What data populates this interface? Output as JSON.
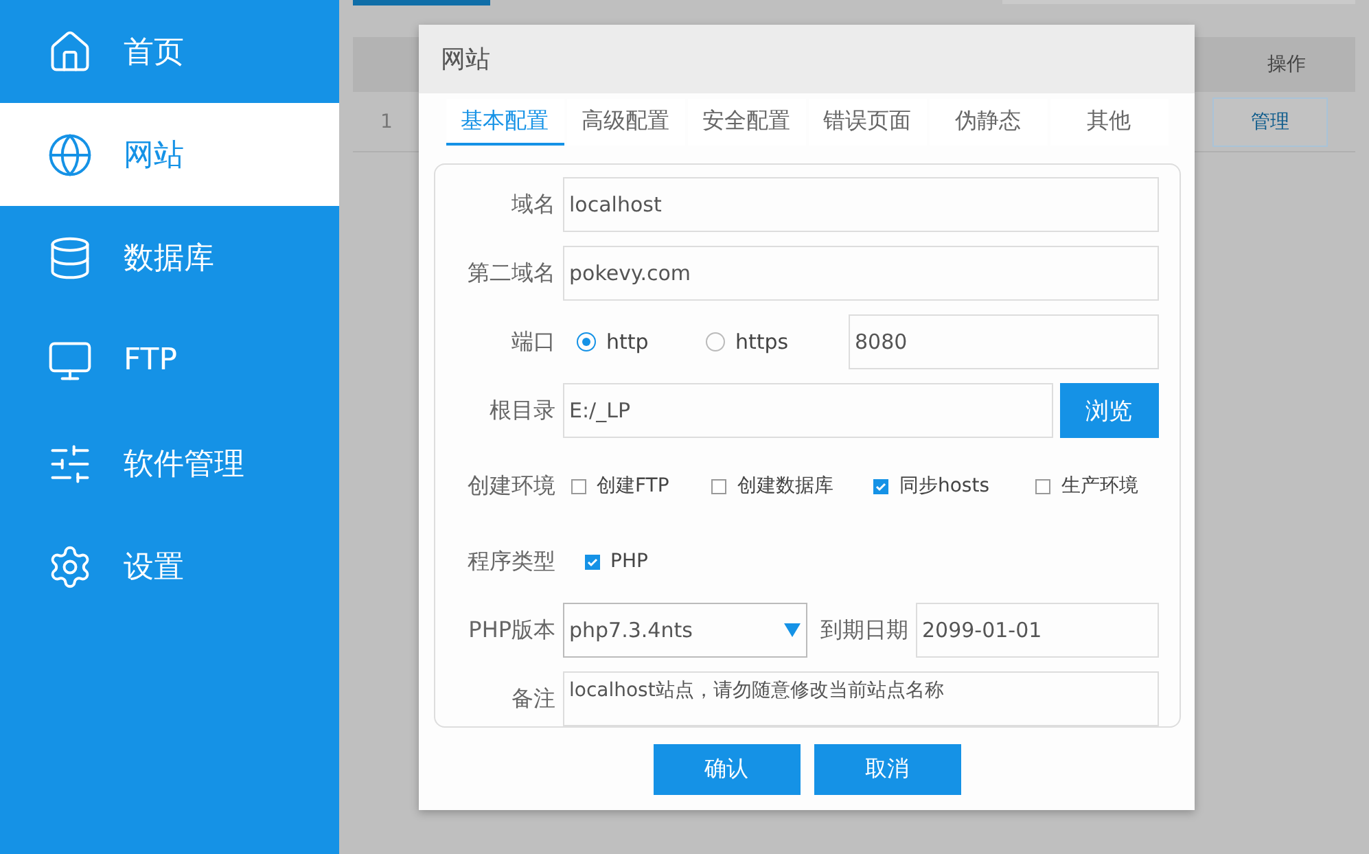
{
  "sidebar": {
    "items": [
      {
        "label": "首页",
        "selected": false
      },
      {
        "label": "网站",
        "selected": true
      },
      {
        "label": "数据库",
        "selected": false
      },
      {
        "label": "FTP",
        "selected": false
      },
      {
        "label": "软件管理",
        "selected": false
      },
      {
        "label": "设置",
        "selected": false
      }
    ]
  },
  "table": {
    "columns": [
      "操作"
    ],
    "rows": [
      {
        "index": "1",
        "action": "管理"
      }
    ]
  },
  "dialog": {
    "title": "网站",
    "tabs": [
      {
        "label": "基本配置",
        "selected": true
      },
      {
        "label": "高级配置",
        "selected": false
      },
      {
        "label": "安全配置",
        "selected": false
      },
      {
        "label": "错误页面",
        "selected": false
      },
      {
        "label": "伪静态",
        "selected": false
      },
      {
        "label": "其他",
        "selected": false
      }
    ],
    "domain": {
      "label": "域名",
      "value": "localhost"
    },
    "second_domain": {
      "label": "第二域名",
      "value": "pokevy.com"
    },
    "port": {
      "label": "端口",
      "protocols": [
        {
          "label": "http",
          "selected": true
        },
        {
          "label": "https",
          "selected": false
        }
      ],
      "value": "8080"
    },
    "root": {
      "label": "根目录",
      "value": "E:/_LP",
      "button": "浏览"
    },
    "environment": {
      "label": "创建环境",
      "options": [
        {
          "label": "创建FTP",
          "checked": false
        },
        {
          "label": "创建数据库",
          "checked": false
        },
        {
          "label": "同步hosts",
          "checked": true
        },
        {
          "label": "生产环境",
          "checked": false
        }
      ]
    },
    "program_type": {
      "label": "程序类型",
      "options": [
        {
          "label": "PHP",
          "checked": true
        }
      ]
    },
    "php_version": {
      "label": "PHP版本",
      "value": "php7.3.4nts"
    },
    "expiry": {
      "label": "到期日期",
      "value": "2099-01-01"
    },
    "note": {
      "label": "备注",
      "value": "localhost站点，请勿随意修改当前站点名称"
    },
    "buttons": [
      "确认",
      "取消"
    ]
  }
}
